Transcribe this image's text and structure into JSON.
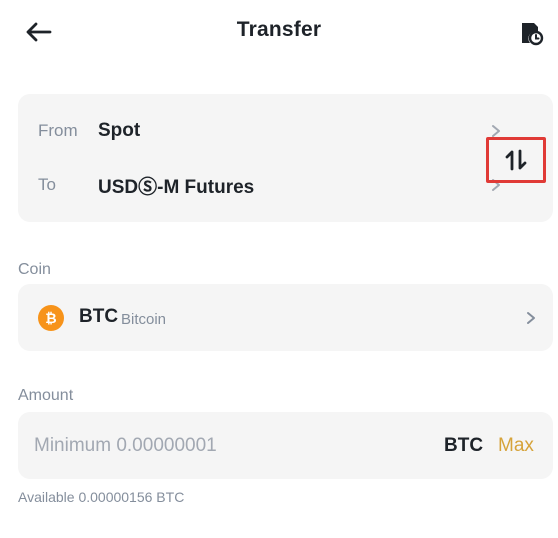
{
  "header": {
    "title": "Transfer",
    "back_icon": "arrow-left-icon",
    "history_icon": "transfer-history-icon"
  },
  "transfer": {
    "from_label": "From",
    "from_value": "Spot",
    "to_label": "To",
    "to_value": "USDⓈ-M Futures",
    "swap_icon": "swap-vertical-icon",
    "highlight_color": "#e03a36"
  },
  "coin": {
    "label": "Coin",
    "symbol": "BTC",
    "name": "Bitcoin",
    "icon": "bitcoin-icon",
    "icon_color": "#f7931a"
  },
  "amount": {
    "label": "Amount",
    "placeholder": "Minimum 0.00000001",
    "value": "",
    "unit": "BTC",
    "max_label": "Max",
    "max_color": "#d6a33a"
  },
  "available": "Available 0.00000156 BTC"
}
